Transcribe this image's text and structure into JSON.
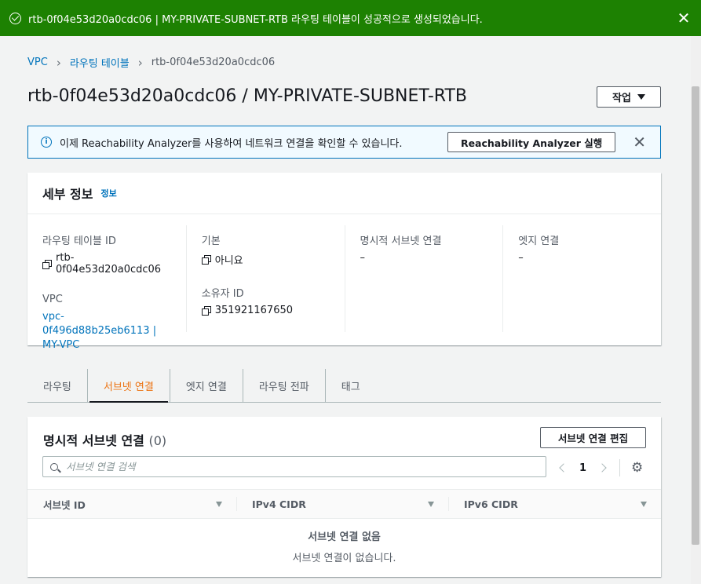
{
  "flash": {
    "message": "rtb-0f04e53d20a0cdc06 | MY-PRIVATE-SUBNET-RTB 라우팅 테이블이 성공적으로 생성되었습니다.",
    "dismiss": "✕",
    "color": "#1d8102"
  },
  "breadcrumbs": [
    {
      "label": "VPC"
    },
    {
      "label": "라우팅 테이블"
    },
    {
      "label": "rtb-0f04e53d20a0cdc06"
    }
  ],
  "page": {
    "title": "rtb-0f04e53d20a0cdc06 / MY-PRIVATE-SUBNET-RTB",
    "actions_label": "작업"
  },
  "info_alert": {
    "text": "이제 Reachability Analyzer를 사용하여 네트워크 연결을 확인할 수 있습니다.",
    "button": "Reachability Analyzer 실행",
    "dismiss": "✕"
  },
  "details": {
    "heading": "세부 정보",
    "info_link": "정보",
    "fields": {
      "route_table_id": {
        "label": "라우팅 테이블 ID",
        "value": "rtb-0f04e53d20a0cdc06"
      },
      "vpc": {
        "label": "VPC",
        "value_line1": "vpc-0f496d88b25eb6113 |",
        "value_line2": "MY-VPC"
      },
      "main": {
        "label": "기본",
        "value": "아니요"
      },
      "owner_id": {
        "label": "소유자 ID",
        "value": "351921167650"
      },
      "explicit_subnet": {
        "label": "명시적 서브넷 연결",
        "value": "–"
      },
      "edge": {
        "label": "엣지 연결",
        "value": "–"
      }
    }
  },
  "tabs": [
    {
      "label": "라우팅",
      "active": false
    },
    {
      "label": "서브넷 연결",
      "active": true
    },
    {
      "label": "엣지 연결",
      "active": false
    },
    {
      "label": "라우팅 전파",
      "active": false
    },
    {
      "label": "태그",
      "active": false
    }
  ],
  "subnet_section": {
    "title": "명시적 서브넷 연결",
    "count": "(0)",
    "edit_button": "서브넷 연결 편집",
    "search_placeholder": "서브넷 연결 검색",
    "page": "1",
    "columns": [
      "서브넷 ID",
      "IPv4 CIDR",
      "IPv6 CIDR"
    ],
    "empty_title": "서브넷 연결 없음",
    "empty_text": "서브넷 연결이 없습니다."
  },
  "colors": {
    "link": "#0073bb",
    "active_tab": "#ec7211",
    "info_bg": "#f1faff"
  },
  "icons": [
    "check-circle-icon",
    "close-icon",
    "chevron-right-icon",
    "caret-down-icon",
    "info-icon",
    "copy-icon",
    "search-icon",
    "chevron-left-icon",
    "gear-icon",
    "sort-icon"
  ]
}
